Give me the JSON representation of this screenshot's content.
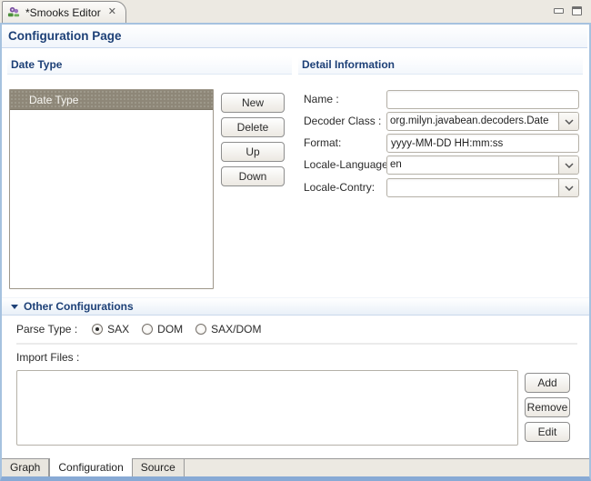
{
  "editor_tab": {
    "title": "*Smooks Editor",
    "close_glyph": "✕"
  },
  "page": {
    "title": "Configuration Page"
  },
  "date_type": {
    "section_title": "Date Type",
    "list_header": "Date Type",
    "items": [],
    "buttons": {
      "new": "New",
      "delete": "Delete",
      "up": "Up",
      "down": "Down"
    }
  },
  "detail": {
    "section_title": "Detail Information",
    "name_label": "Name :",
    "name_value": "",
    "decoder_label": "Decoder Class :",
    "decoder_value": "org.milyn.javabean.decoders.Date",
    "format_label": "Format:",
    "format_value": "yyyy-MM-DD HH:mm:ss",
    "locale_language_label": "Locale-Language:",
    "locale_language_value": "en",
    "locale_country_label": "Locale-Contry:",
    "locale_country_value": ""
  },
  "other": {
    "section_title": "Other Configurations",
    "parse_type_label": "Parse Type :",
    "parse_options": [
      "SAX",
      "DOM",
      "SAX/DOM"
    ],
    "parse_selected": "SAX",
    "import_label": "Import Files :",
    "import_items": [],
    "buttons": {
      "add": "Add",
      "remove": "Remove",
      "edit": "Edit"
    }
  },
  "bottom_tabs": {
    "labels": [
      "Graph",
      "Configuration",
      "Source"
    ],
    "active": "Configuration"
  },
  "colors": {
    "section_title": "#1D4077",
    "list_header_bg": "#8E8778",
    "frame_border": "#A6C2DF",
    "bottom_band": "#88AAD5",
    "window_bg": "#ECE9E2"
  }
}
